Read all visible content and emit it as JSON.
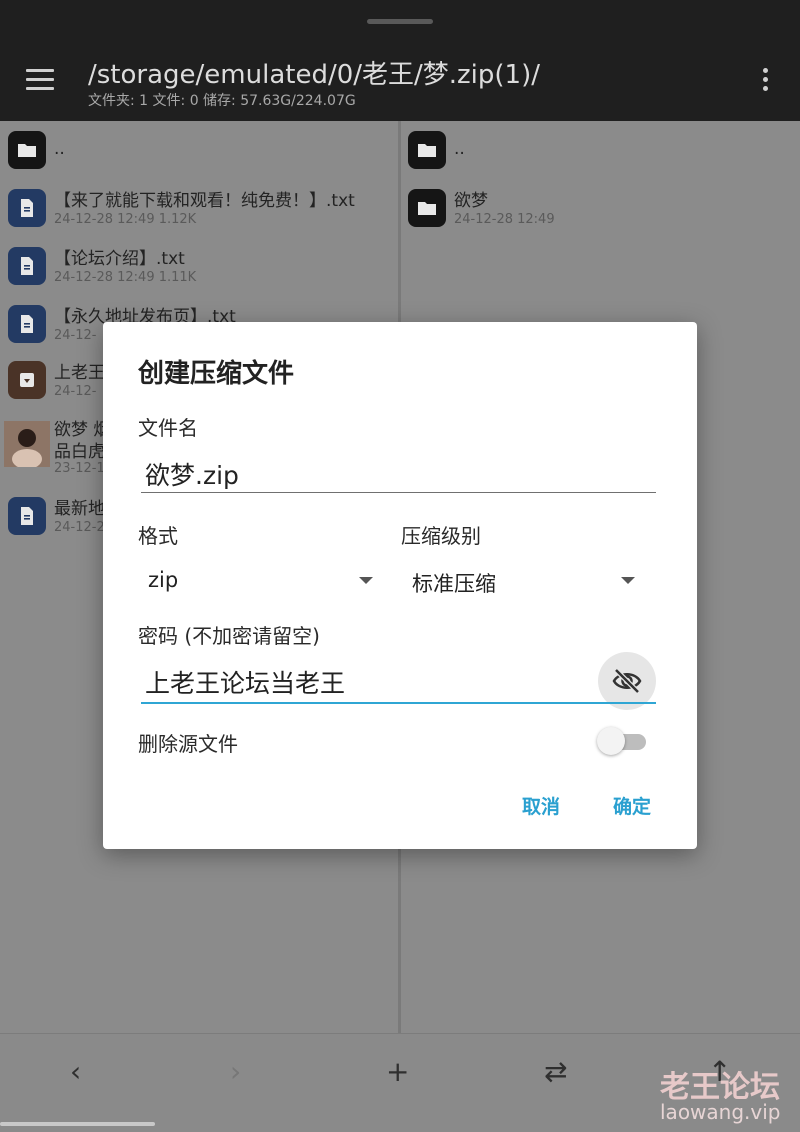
{
  "header": {
    "path_title": "/storage/emulated/0/老王/梦.zip(1)/",
    "path_info": "文件夹: 1  文件: 0  储存: 57.63G/224.07G"
  },
  "left_pane": {
    "items": [
      {
        "name": "..",
        "meta": "",
        "icon": "folder-icon"
      },
      {
        "name": "【来了就能下载和观看！纯免费！】.txt",
        "meta": "24-12-28 12:49  1.12K",
        "icon": "text-file-icon"
      },
      {
        "name": "【论坛介绍】.txt",
        "meta": "24-12-28 12:49  1.11K",
        "icon": "text-file-icon"
      },
      {
        "name": "【永久地址发布页】.txt",
        "meta": "24-12-",
        "icon": "text-file-icon"
      },
      {
        "name": "上老王",
        "meta": "24-12-",
        "icon": "archive-icon"
      },
      {
        "name": "欲梦 烟",
        "name2": "品白虎",
        "meta": "23-12-1",
        "icon": "image-thumbnail"
      },
      {
        "name": "最新地",
        "meta": "24-12-2",
        "icon": "text-file-icon"
      }
    ]
  },
  "right_pane": {
    "items": [
      {
        "name": "..",
        "meta": "",
        "icon": "folder-icon"
      },
      {
        "name": "欲梦",
        "meta": "24-12-28 12:49",
        "icon": "folder-icon"
      }
    ]
  },
  "dialog": {
    "title": "创建压缩文件",
    "filename_label": "文件名",
    "filename_value": "欲梦.zip",
    "format_label": "格式",
    "format_value": "zip",
    "level_label": "压缩级别",
    "level_value": "标准压缩",
    "password_label": "密码 (不加密请留空)",
    "password_value": "上老王论坛当老王",
    "delete_source_label": "删除源文件",
    "delete_source_on": false,
    "cancel_label": "取消",
    "ok_label": "确定"
  },
  "bottom_bar": {
    "back_icon": "‹",
    "forward_icon": "›",
    "add_icon": "+",
    "swap_icon": "⇄",
    "up_icon": "↑"
  },
  "watermark": {
    "line1": "老王论坛",
    "line2": "laowang.vip"
  },
  "colors": {
    "accent": "#2aa0d0",
    "topbar": "#1f1f1f",
    "folder_icon_bg": "#151515",
    "doc_icon_bg": "#233a63"
  }
}
